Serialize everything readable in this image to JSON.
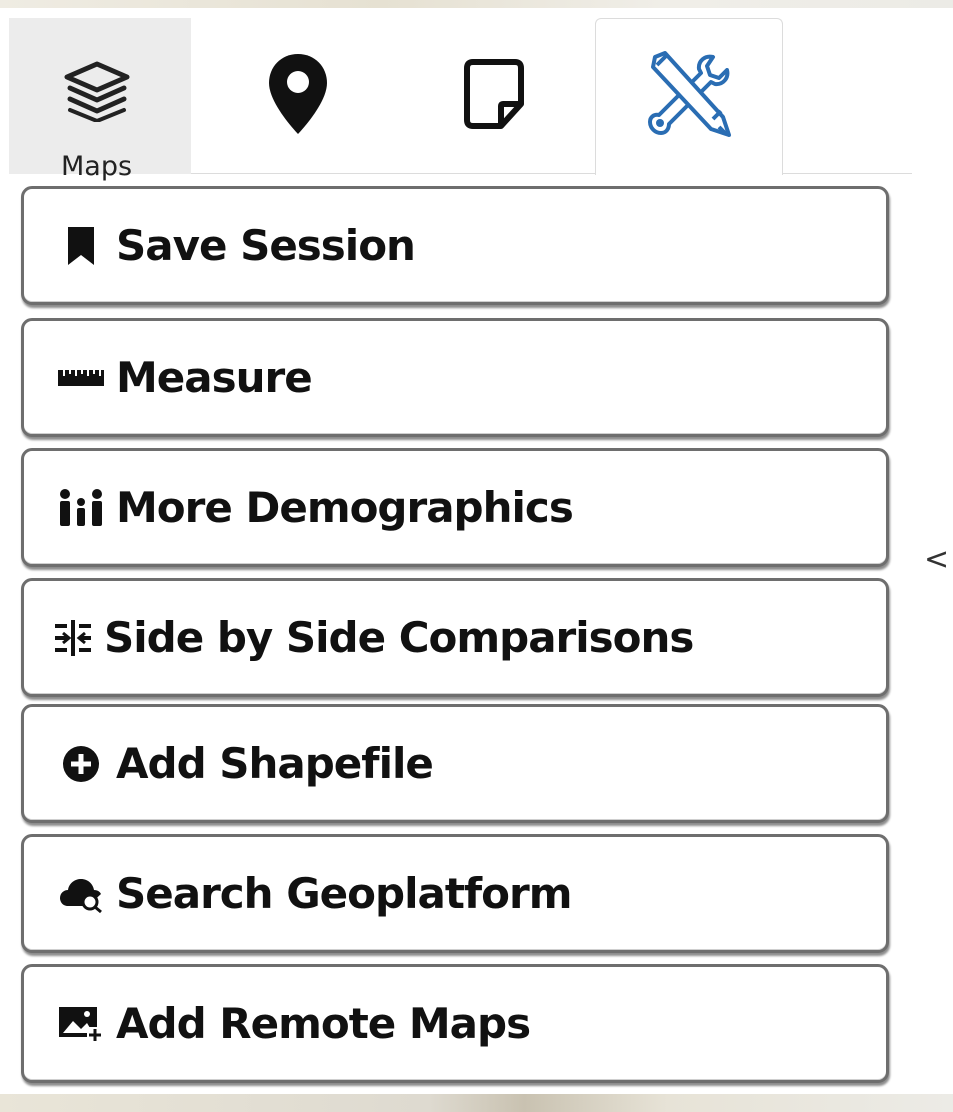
{
  "tabs": {
    "maps": {
      "label": "Maps",
      "icon": "layers-icon"
    },
    "places": {
      "icon": "map-pin-icon"
    },
    "notes": {
      "icon": "note-icon"
    },
    "tools": {
      "icon": "tools-icon",
      "color": "#2a6db3"
    }
  },
  "tools_menu": {
    "items": [
      {
        "label": "Save Session",
        "icon": "bookmark-icon"
      },
      {
        "label": "Measure",
        "icon": "ruler-icon"
      },
      {
        "label": "More Demographics",
        "icon": "people-icon"
      },
      {
        "label": "Side by Side Comparisons",
        "icon": "compare-icon"
      },
      {
        "label": "Add Shapefile",
        "icon": "plus-circle-icon"
      },
      {
        "label": "Search Geoplatform",
        "icon": "cloud-search-icon"
      },
      {
        "label": "Add Remote Maps",
        "icon": "add-image-icon"
      }
    ]
  },
  "panel": {
    "collapse_label": "<"
  }
}
